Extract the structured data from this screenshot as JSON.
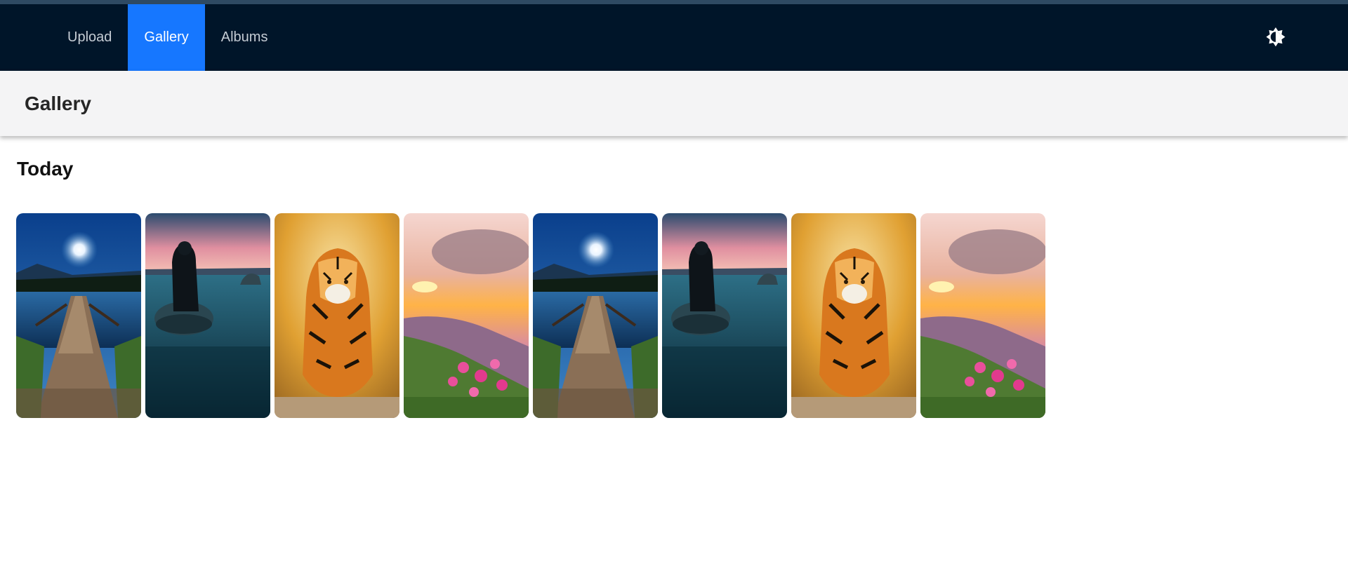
{
  "nav": {
    "items": [
      {
        "label": "Upload",
        "active": false
      },
      {
        "label": "Gallery",
        "active": true
      },
      {
        "label": "Albums",
        "active": false
      }
    ],
    "theme_toggle_icon": "brightness-icon"
  },
  "header": {
    "title": "Gallery"
  },
  "section": {
    "title": "Today"
  },
  "gallery": {
    "photos": [
      {
        "subject": "moonlit-dock"
      },
      {
        "subject": "person-on-rock"
      },
      {
        "subject": "tiger"
      },
      {
        "subject": "sunset-flowers"
      },
      {
        "subject": "moonlit-dock"
      },
      {
        "subject": "person-on-rock"
      },
      {
        "subject": "tiger"
      },
      {
        "subject": "sunset-flowers"
      }
    ]
  },
  "colors": {
    "nav_bg": "#001529",
    "accent": "#1677ff"
  }
}
